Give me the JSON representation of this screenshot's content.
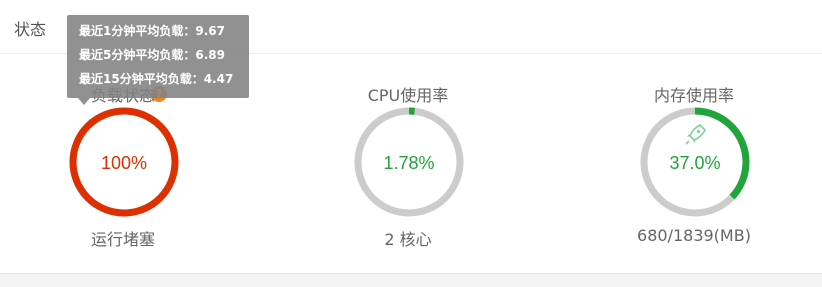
{
  "panel": {
    "title": "状态"
  },
  "tooltip": {
    "lines": [
      "最近1分钟平均负载：9.67",
      "最近5分钟平均负载：6.89",
      "最近15分钟平均负载：4.47"
    ]
  },
  "gauges": [
    {
      "label": "负载状态",
      "value": "100%",
      "percent": 100,
      "sub": "运行堵塞",
      "color": "#dd2f00",
      "icon": "info-icon",
      "icon_text": "?"
    },
    {
      "label": "CPU使用率",
      "value": "1.78%",
      "percent": 1.78,
      "sub": "2 核心",
      "color": "#20a53a"
    },
    {
      "label": "内存使用率",
      "value": "37.0%",
      "percent": 37.0,
      "sub": "680/1839(MB)",
      "color": "#20a53a",
      "icon": "rocket-icon"
    }
  ],
  "colors": {
    "track": "#cccccc",
    "danger": "#dd2f00",
    "ok": "#20a53a"
  }
}
